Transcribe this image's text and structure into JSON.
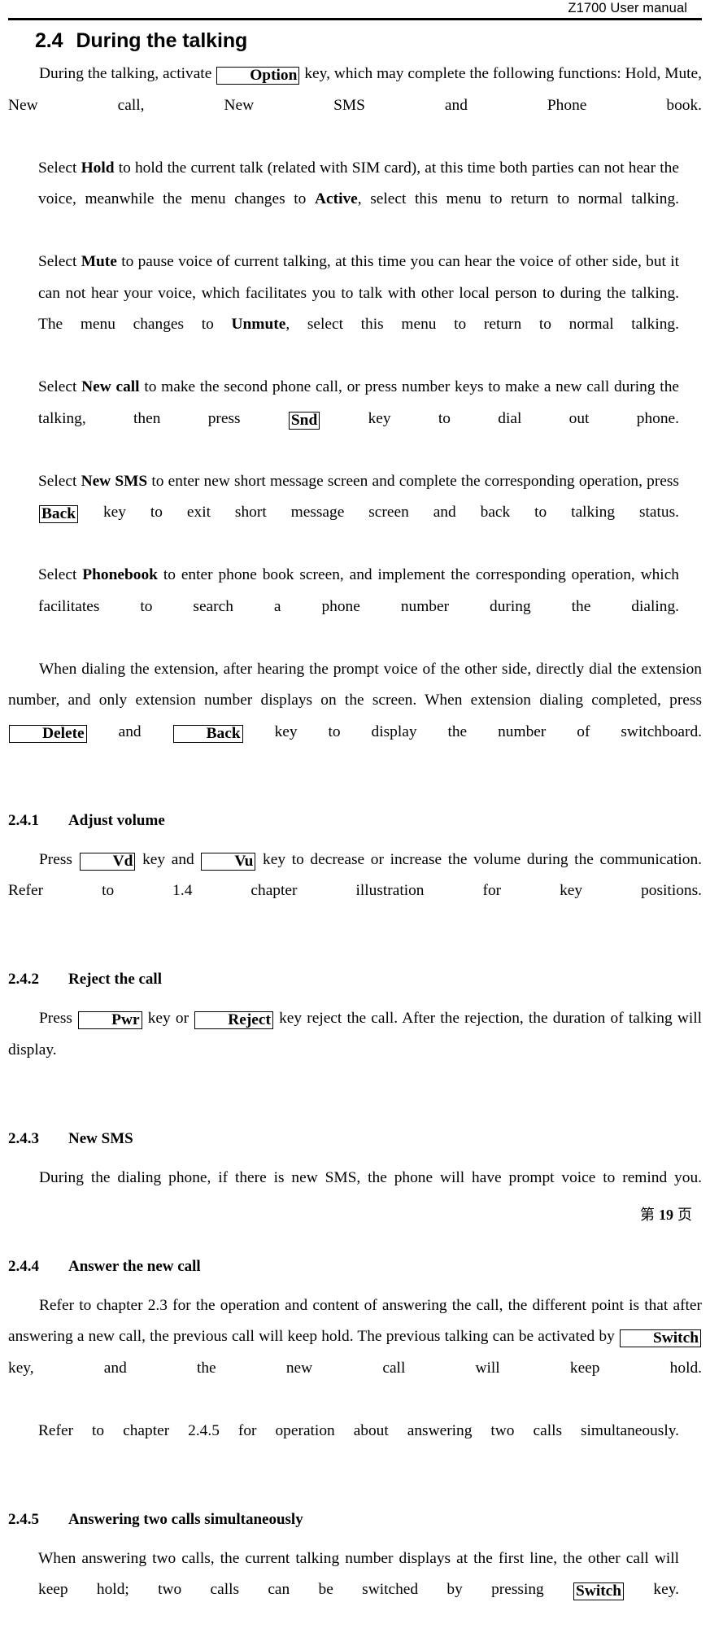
{
  "header": {
    "running_title": "Z1700 User manual"
  },
  "section": {
    "number": "2.4",
    "title": "During the talking"
  },
  "intro": {
    "part1": "During the talking, activate",
    "key_option": "Option",
    "part2": "key, which may complete the following functions: Hold, Mute, New call, New SMS and Phone book."
  },
  "hold": {
    "lead": "Select",
    "term": "Hold",
    "part1": "to hold the current talk (related with SIM card), at this time both parties can not hear the voice, meanwhile the menu changes to",
    "term2": "Active",
    "part2": ", select this menu to return to normal talking."
  },
  "mute": {
    "lead": "Select",
    "term": "Mute",
    "part1": "to pause voice of current talking, at this time you can hear the voice of other side, but it can not hear your voice, which facilitates you to talk with other local person to during the talking. The menu changes to",
    "term2": "Unmute",
    "part2": ", select this menu to return to normal talking."
  },
  "new_call": {
    "lead": "Select",
    "term": "New call",
    "part1": "to make the second phone call, or press number keys to make a new call during the talking, then press",
    "key_snd": "Snd",
    "part2": "key to dial out phone."
  },
  "new_sms": {
    "lead": "Select",
    "term": "New SMS",
    "part1": "to enter new short message screen and complete the corresponding operation, press",
    "key_back": "Back",
    "part2": "key to exit short message screen and back to talking status."
  },
  "phonebook": {
    "lead": "Select",
    "term": "Phonebook",
    "part1": "to enter phone book screen, and implement the corresponding operation, which facilitates to search a phone number during the dialing."
  },
  "extension": {
    "part1": "When dialing the extension, after hearing the prompt voice of the other side, directly dial the extension number, and only extension number displays on the screen. When extension dialing completed, press",
    "key_delete": "Delete",
    "mid": "and",
    "key_back": "Back",
    "part2": "key to display the number of switchboard."
  },
  "sub_2_4_1": {
    "number": "2.4.1",
    "title": "Adjust volume",
    "body_part1": "Press",
    "key_vd": "Vd",
    "body_mid1": "key and",
    "key_vu": "Vu",
    "body_part2": "key to decrease or increase the volume during the communication. Refer to 1.4 chapter illustration for key positions."
  },
  "sub_2_4_2": {
    "number": "2.4.2",
    "title": "Reject the call",
    "body_part1": "Press",
    "key_pwr": "Pwr",
    "body_mid1": "key or",
    "key_reject": "Reject",
    "body_part2": "key reject the call. After the rejection, the duration of talking will display."
  },
  "sub_2_4_3": {
    "number": "2.4.3",
    "title": "New SMS",
    "body": "During the dialing phone, if there is new SMS, the phone will have prompt voice to remind you."
  },
  "sub_2_4_4": {
    "number": "2.4.4",
    "title": "Answer the new call",
    "body_part1": "Refer to chapter 2.3 for the operation and content of answering the call, the different point is that after answering a new call, the previous call will keep hold. The previous talking can be activated by",
    "key_switch": "Switch",
    "body_part2": "key, and the new call will keep hold.",
    "body_line2": "Refer to chapter 2.4.5 for operation about answering two calls simultaneously."
  },
  "sub_2_4_5": {
    "number": "2.4.5",
    "title": "Answering two calls simultaneously",
    "body_part1": "When answering two calls, the current talking number displays at the first line, the other call will keep hold; two calls can be switched by pressing",
    "key_switch": "Switch",
    "body_part2": "key."
  },
  "footer": {
    "prefix": "第",
    "page_number": "19",
    "suffix": "页"
  }
}
